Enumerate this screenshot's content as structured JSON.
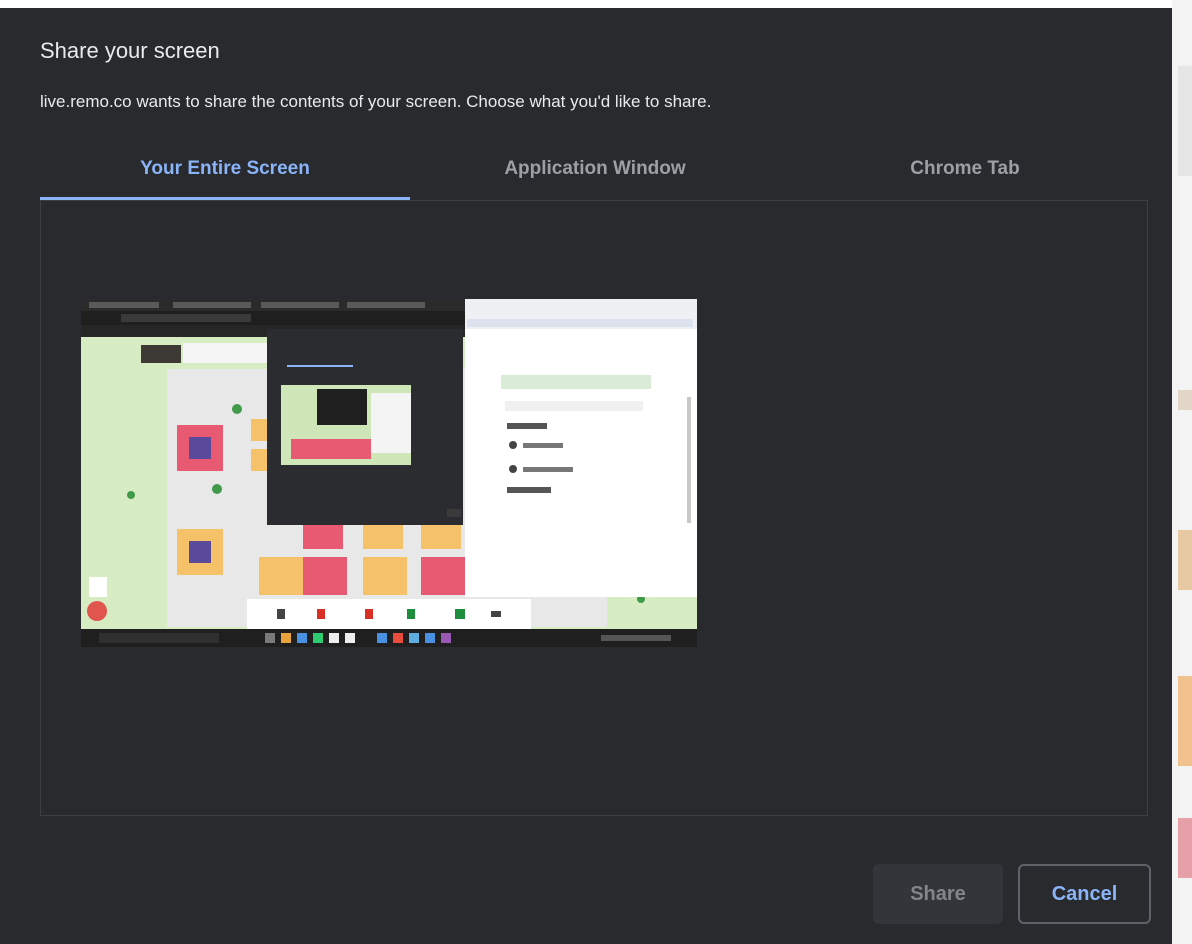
{
  "dialog": {
    "title": "Share your screen",
    "description": "live.remo.co wants to share the contents of your screen. Choose what you'd like to share.",
    "tabs": [
      {
        "label": "Your Entire Screen",
        "active": true
      },
      {
        "label": "Application Window",
        "active": false
      },
      {
        "label": "Chrome Tab",
        "active": false
      }
    ],
    "buttons": {
      "share_label": "Share",
      "cancel_label": "Cancel"
    }
  },
  "colors": {
    "background": "#292a2d",
    "accent": "#8ab4f8",
    "text": "#e8eaed",
    "muted_text": "#9aa0a6"
  }
}
